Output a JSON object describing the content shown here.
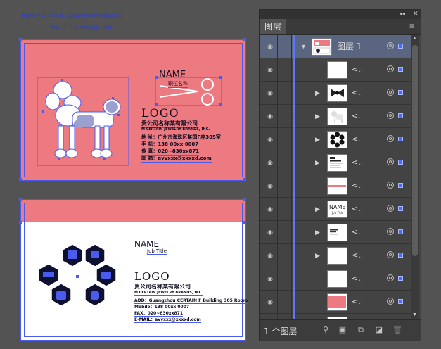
{
  "canvas": {
    "note_line1": "横版名片90~55mm，设置2mm印刷切裁出血位",
    "note_line2": "字体：方正兰亭黑简体，Arial",
    "front": {
      "name": "NAME",
      "job_title": "职位名称",
      "logo": "LOGO",
      "company_cn": "贵公司名称某有限公司",
      "company_en": "M CERTAIN JEWELRY BRANDS, INC.",
      "address": "地 址：广州市海珠区某国F座305室",
      "mobile": "手 机：138 00xx 0007",
      "phone": "传 真：020~830xx871",
      "email": "邮 箱：avvxxx@xxxxd.com",
      "accent": "#ec7a80"
    },
    "back": {
      "name": "NAME",
      "job_title": "Job Title",
      "logo": "LOGO",
      "company_cn": "贵公司名称某有限公司",
      "company_en": "M CERTAIN JEWELRY BRANDS, INC.",
      "address": "ADD：Guangzhou CERTAIN F Building 305 Room",
      "mobile": "Mobile：138 00xx 0007",
      "fax": "FAX：020~830xx871",
      "email": "E-MAIL：avvxxx@xxxxd.com"
    }
  },
  "panel": {
    "collapse_glyph": "◂◂",
    "close_glyph": "✕",
    "tab_label": "图层",
    "menu_glyph": "≡",
    "selection_color": "#4a6bff",
    "layers": [
      {
        "name": "图层 1",
        "expanded": true,
        "selected": true,
        "thumb": "layer-card"
      },
      {
        "name": "<..",
        "has_arrow": false,
        "thumb": "blank"
      },
      {
        "name": "<..",
        "has_arrow": true,
        "thumb": "bowtie"
      },
      {
        "name": "<..",
        "has_arrow": true,
        "thumb": "poodle"
      },
      {
        "name": "<..",
        "has_arrow": true,
        "thumb": "hexflower"
      },
      {
        "name": "<..",
        "has_arrow": true,
        "thumb": "textblock"
      },
      {
        "name": "<..",
        "has_arrow": false,
        "thumb": "redline"
      },
      {
        "name": "<..",
        "has_arrow": true,
        "thumb": "nametitle"
      },
      {
        "name": "<..",
        "has_arrow": true,
        "thumb": "smalltext"
      },
      {
        "name": "<..",
        "has_arrow": true,
        "thumb": "blank"
      },
      {
        "name": "<..",
        "has_arrow": false,
        "thumb": "blank"
      },
      {
        "name": "<..",
        "has_arrow": false,
        "thumb": "pinkrect"
      },
      {
        "name": "<..",
        "has_arrow": false,
        "thumb": "blank"
      }
    ],
    "footer": {
      "layer_count": "1 个图层",
      "icons": [
        "locate-object-icon",
        "make-clipping-mask-icon",
        "new-sublayer-icon",
        "new-layer-icon",
        "delete-layer-icon"
      ]
    }
  }
}
